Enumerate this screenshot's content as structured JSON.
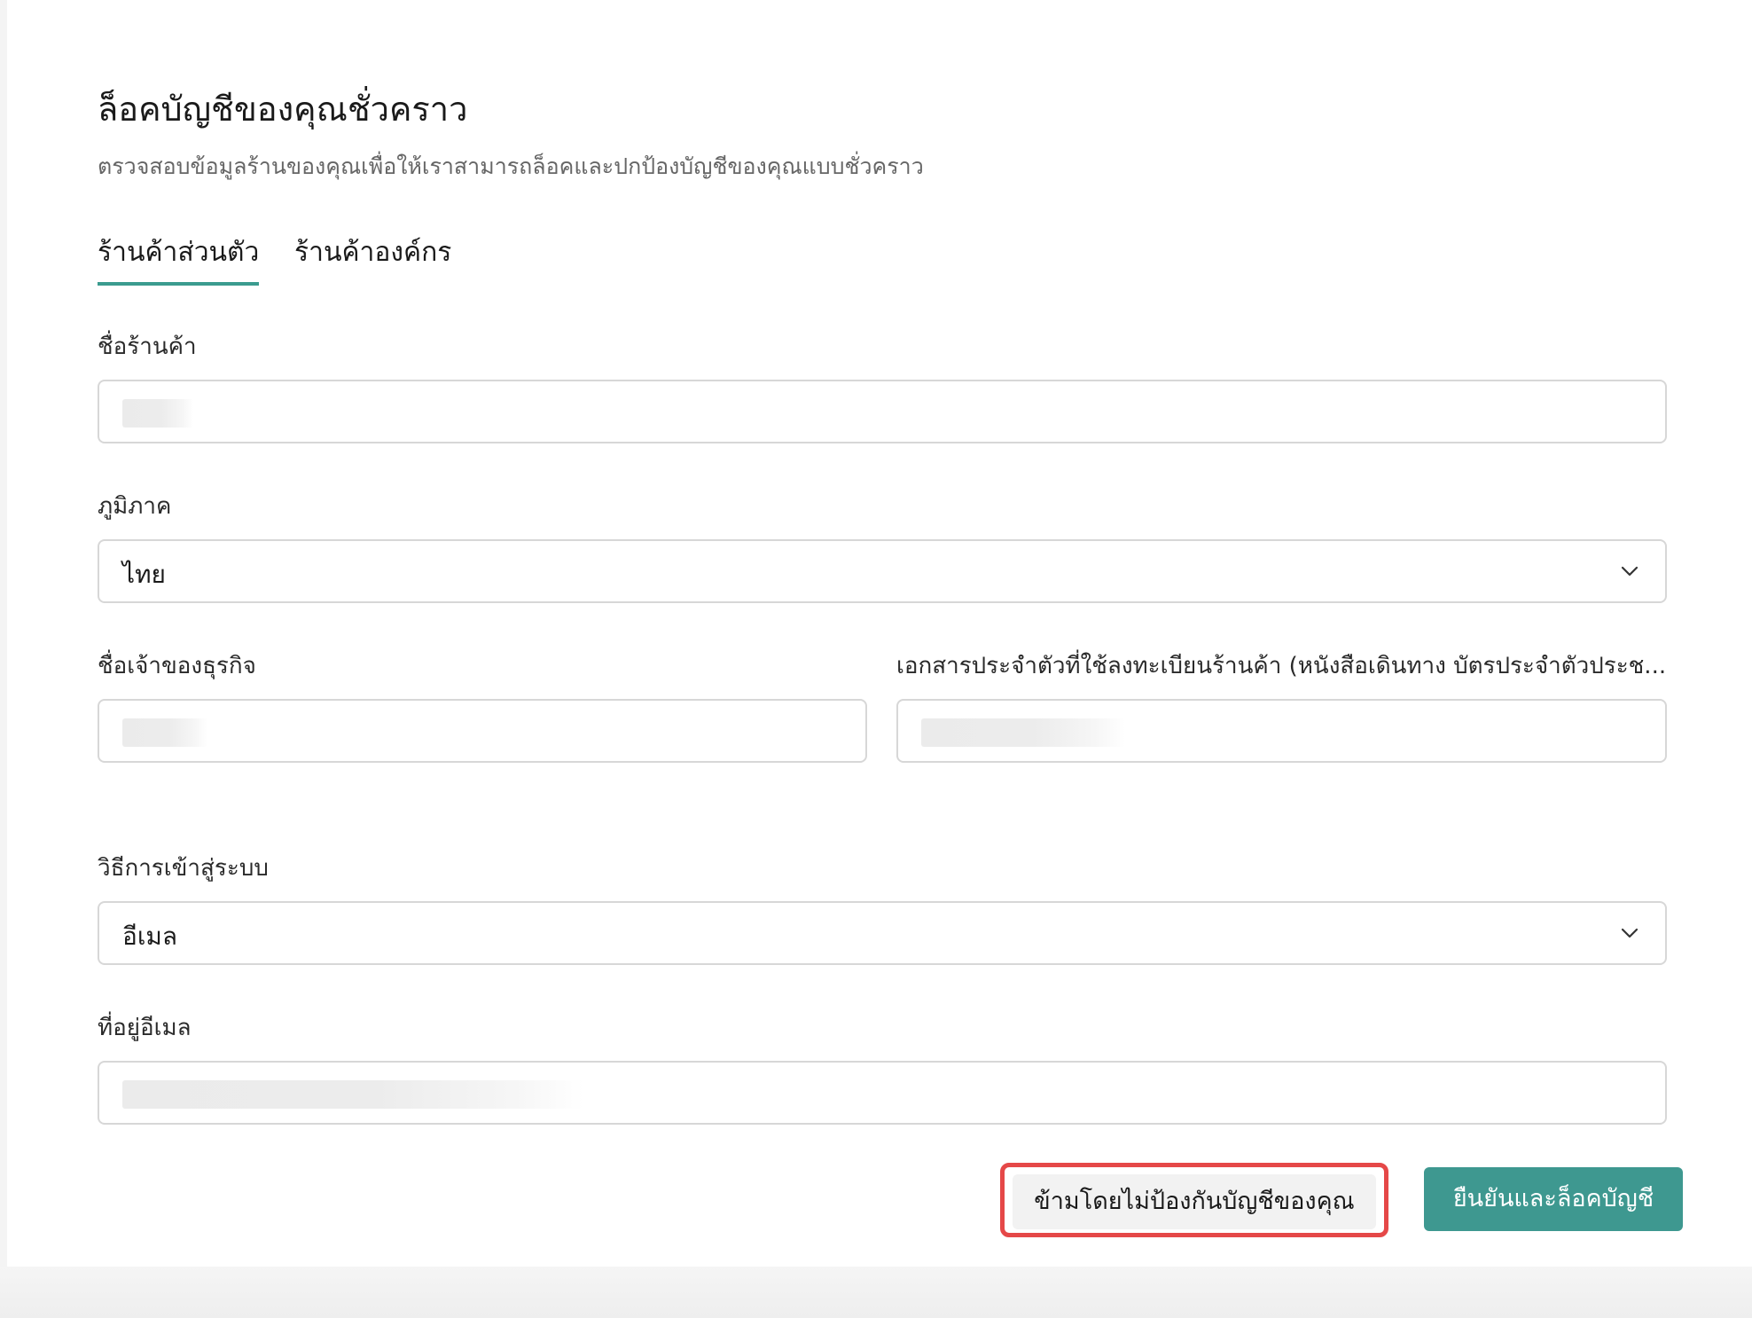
{
  "header": {
    "title": "ล็อคบัญชีของคุณชั่วคราว",
    "subtitle": "ตรวจสอบข้อมูลร้านของคุณเพื่อให้เราสามารถล็อคและปกป้องบัญชีของคุณแบบชั่วคราว"
  },
  "tabs": [
    {
      "label": "ร้านค้าส่วนตัว",
      "active": true
    },
    {
      "label": "ร้านค้าองค์กร",
      "active": false
    }
  ],
  "form": {
    "shop_name": {
      "label": "ชื่อร้านค้า"
    },
    "region": {
      "label": "ภูมิภาค",
      "value": "ไทย"
    },
    "owner_name": {
      "label": "ชื่อเจ้าของธุรกิจ"
    },
    "id_document": {
      "label": "เอกสารประจำตัวที่ใช้ลงทะเบียนร้านค้า (หนังสือเดินทาง บัตรประจำตัวประช..."
    },
    "login_method": {
      "label": "วิธีการเข้าสู่ระบบ",
      "value": "อีเมล"
    },
    "email": {
      "label": "ที่อยู่อีเมล"
    }
  },
  "actions": {
    "skip_label": "ข้ามโดยไม่ป้องกันบัญชีของคุณ",
    "confirm_label": "ยืนยันและล็อคบัญชี"
  },
  "colors": {
    "accent": "#3e9890",
    "highlight": "#e54848"
  },
  "icons": {
    "select_chevron": "chevron-down-icon"
  }
}
